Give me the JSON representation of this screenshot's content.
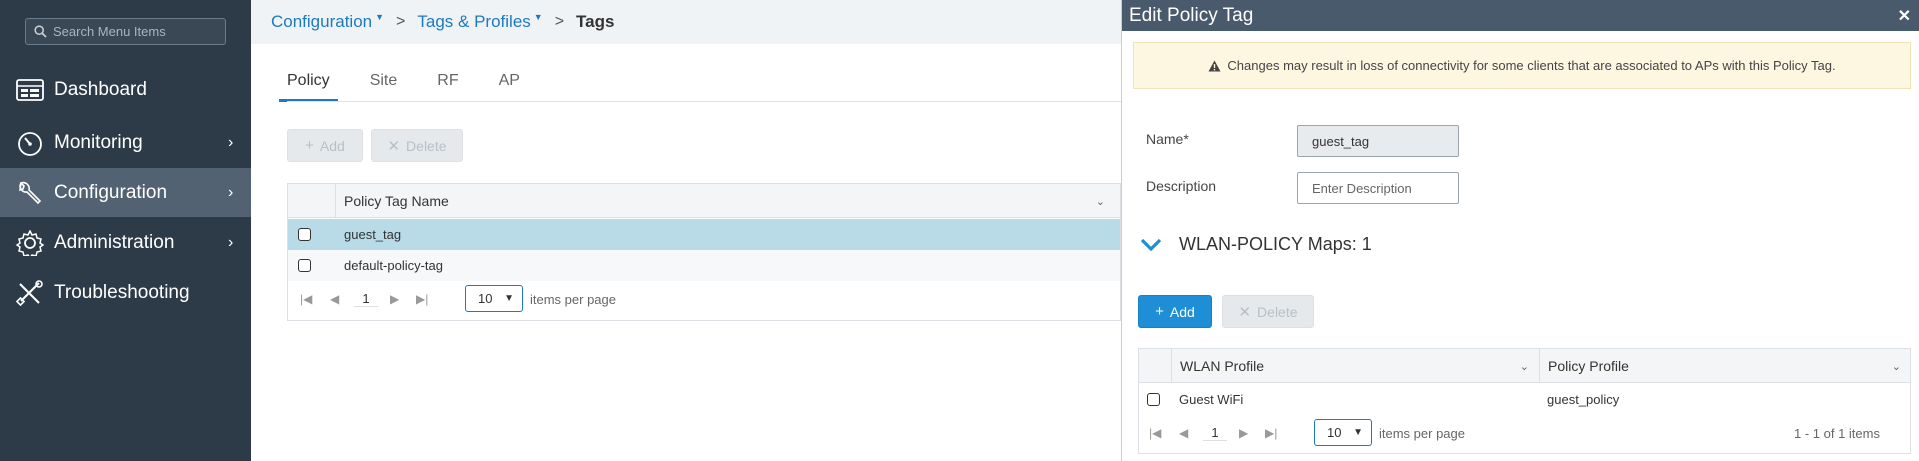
{
  "sidebar": {
    "search_placeholder": "Search Menu Items",
    "items": [
      {
        "label": "Dashboard",
        "icon": "dashboard-icon"
      },
      {
        "label": "Monitoring",
        "icon": "gauge-icon",
        "chevron": "›"
      },
      {
        "label": "Configuration",
        "icon": "wrench-icon",
        "chevron": "›",
        "active": true
      },
      {
        "label": "Administration",
        "icon": "gear-icon",
        "chevron": "›"
      },
      {
        "label": "Troubleshooting",
        "icon": "tools-icon"
      }
    ]
  },
  "breadcrumb": {
    "level1": "Configuration",
    "level2": "Tags & Profiles",
    "current": "Tags",
    "separator": ">"
  },
  "tabs": [
    "Policy",
    "Site",
    "RF",
    "AP"
  ],
  "toolbar": {
    "add_label": "Add",
    "delete_label": "Delete"
  },
  "table": {
    "column_name": "Policy Tag Name",
    "rows": [
      {
        "name": "guest_tag"
      },
      {
        "name": "default-policy-tag"
      }
    ],
    "pager": {
      "page": "1",
      "page_size": "10",
      "items_per_page": "items per page"
    }
  },
  "panel": {
    "title": "Edit Policy Tag",
    "warning": "Changes may result in loss of connectivity for some clients that are associated to APs with this Policy Tag.",
    "name_label": "Name*",
    "name_value": "guest_tag",
    "description_label": "Description",
    "description_placeholder": "Enter Description",
    "section_title": "WLAN-POLICY Maps: 1",
    "add_label": "Add",
    "delete_label": "Delete",
    "map_table": {
      "col_wlan": "WLAN Profile",
      "col_policy": "Policy Profile",
      "rows": [
        {
          "wlan": "Guest WiFi",
          "policy": "guest_policy"
        }
      ],
      "pager": {
        "page": "1",
        "page_size": "10",
        "items_per_page": "items per page",
        "summary": "1 - 1 of 1 items"
      }
    }
  },
  "colors": {
    "sidebar_bg": "#2d3b48",
    "sidebar_active": "#526273",
    "accent": "#1d7ac1",
    "panel_header": "#485a6c",
    "selected_row": "#b8dbe7",
    "warning_bg": "#fdf7e1"
  }
}
